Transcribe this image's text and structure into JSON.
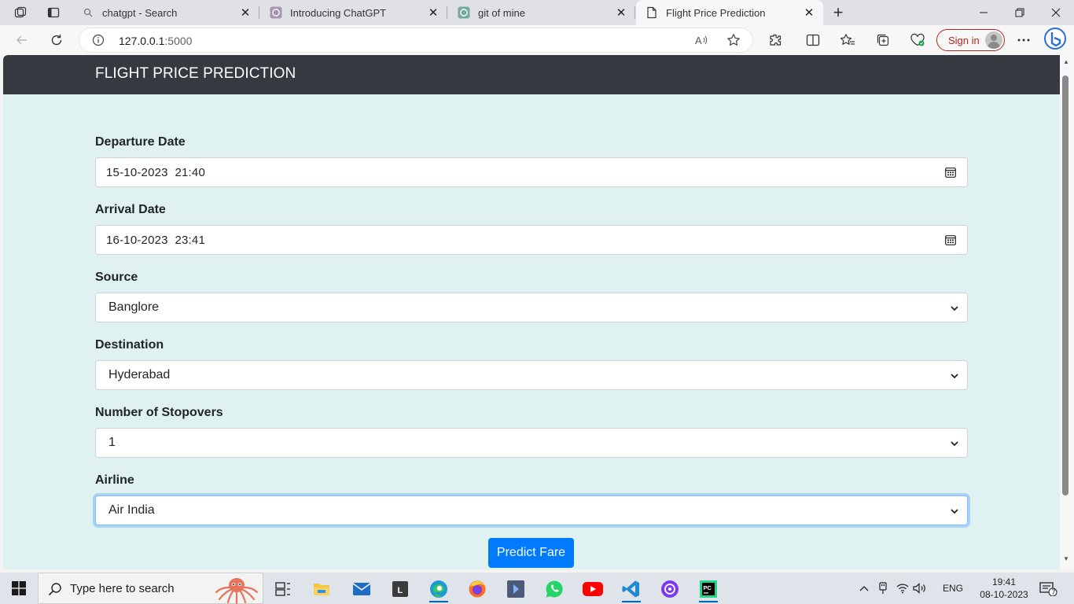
{
  "browser": {
    "tabs": [
      {
        "title": "chatgpt - Search",
        "icon": "search-icon",
        "active": false
      },
      {
        "title": "Introducing ChatGPT",
        "icon": "openai-icon",
        "active": false
      },
      {
        "title": "git of mine",
        "icon": "openai-icon",
        "active": false
      },
      {
        "title": "Flight Price Prediction",
        "icon": "page-icon",
        "active": true
      }
    ],
    "url_host": "127.0.0.1",
    "url_port": ":5000",
    "signin_label": "Sign in"
  },
  "page": {
    "brand": "FLIGHT PRICE PREDICTION",
    "fields": {
      "departure": {
        "label": "Departure Date",
        "value": "15-10-2023  21:40"
      },
      "arrival": {
        "label": "Arrival Date",
        "value": "16-10-2023  23:41"
      },
      "source": {
        "label": "Source",
        "value": "Banglore"
      },
      "destination": {
        "label": "Destination",
        "value": "Hyderabad"
      },
      "stopovers": {
        "label": "Number of Stopovers",
        "value": "1"
      },
      "airline": {
        "label": "Airline",
        "value": "Air India"
      }
    },
    "submit_label": "Predict Fare"
  },
  "taskbar": {
    "search_placeholder": "Type here to search",
    "language": "ENG",
    "time": "19:41",
    "date": "08-10-2023",
    "notification_count": "7"
  },
  "colors": {
    "navbar": "#343a40",
    "page_bg": "#dff1f1",
    "primary": "#007bff"
  }
}
